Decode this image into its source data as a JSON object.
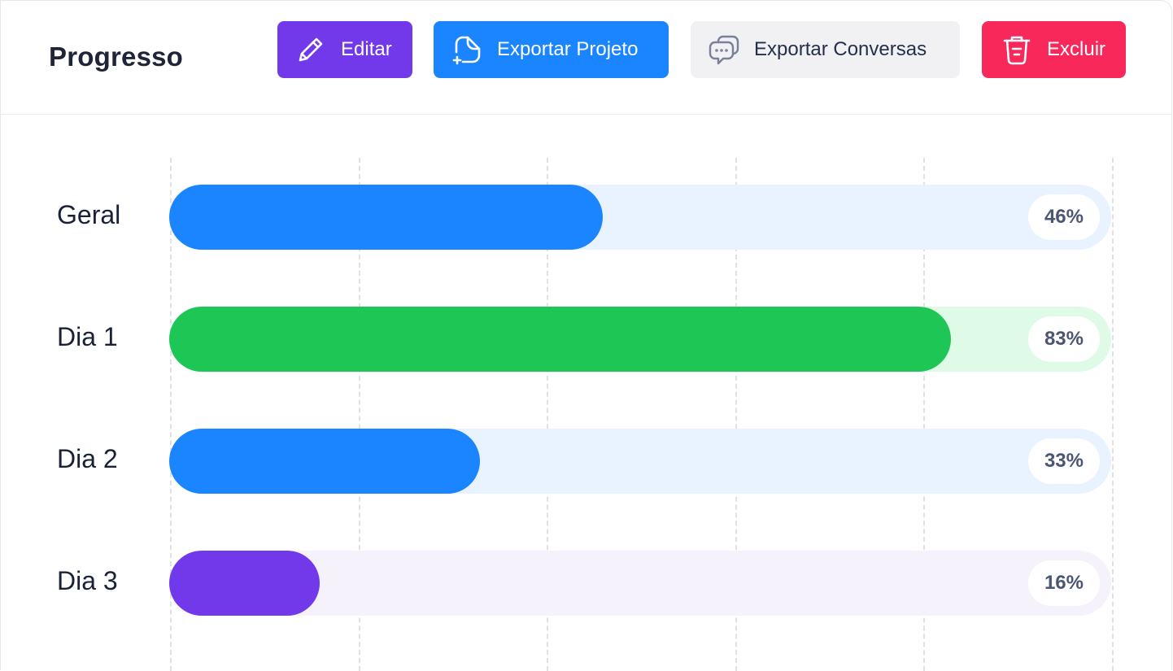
{
  "header": {
    "title": "Progresso",
    "buttons": {
      "edit": "Editar",
      "export_project": "Exportar Projeto",
      "export_conversations": "Exportar Conversas",
      "delete": "Excluir"
    }
  },
  "colors": {
    "purple": "#7239ea",
    "blue": "#1b84ff",
    "green": "#1ec655",
    "red": "#f8285a",
    "light_gray": "#f1f1f4"
  },
  "icons": {
    "edit": "pencil-icon",
    "export_project": "file-export-icon",
    "export_conversations": "chat-bubbles-icon",
    "delete": "trash-icon"
  },
  "progress": [
    {
      "label": "Geral",
      "value": 46,
      "text": "46%",
      "color": "#1b84ff",
      "track": "#e9f3ff"
    },
    {
      "label": "Dia 1",
      "value": 83,
      "text": "83%",
      "color": "#1ec655",
      "track": "#dffbe8"
    },
    {
      "label": "Dia 2",
      "value": 33,
      "text": "33%",
      "color": "#1b84ff",
      "track": "#e9f3ff"
    },
    {
      "label": "Dia 3",
      "value": 16,
      "text": "16%",
      "color": "#7239ea",
      "track": "#f5f2fc"
    }
  ]
}
